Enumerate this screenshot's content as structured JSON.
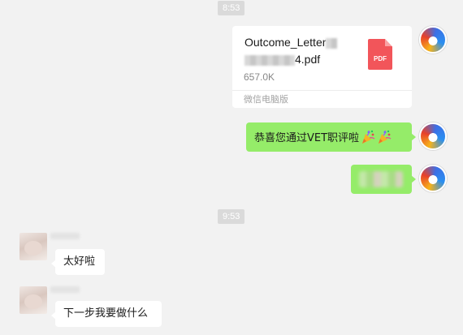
{
  "chat": {
    "time1": "8:53",
    "time2": "9:53",
    "file_card": {
      "name_line1": "Outcome_Letter",
      "name_line2_suffix": "4.pdf",
      "size": "657.0K",
      "source": "微信电脑版",
      "icon_label": "PDF",
      "icon": "pdf-file-icon",
      "icon_color": "#f2555a"
    },
    "msg_congrats": "恭喜您通过VET职评啦",
    "msg_reply1": "太好啦",
    "msg_reply2": "下一步我要做什么",
    "colors": {
      "bubble_self": "#95ec69",
      "bubble_other": "#ffffff",
      "background": "#f2f2f2"
    }
  }
}
